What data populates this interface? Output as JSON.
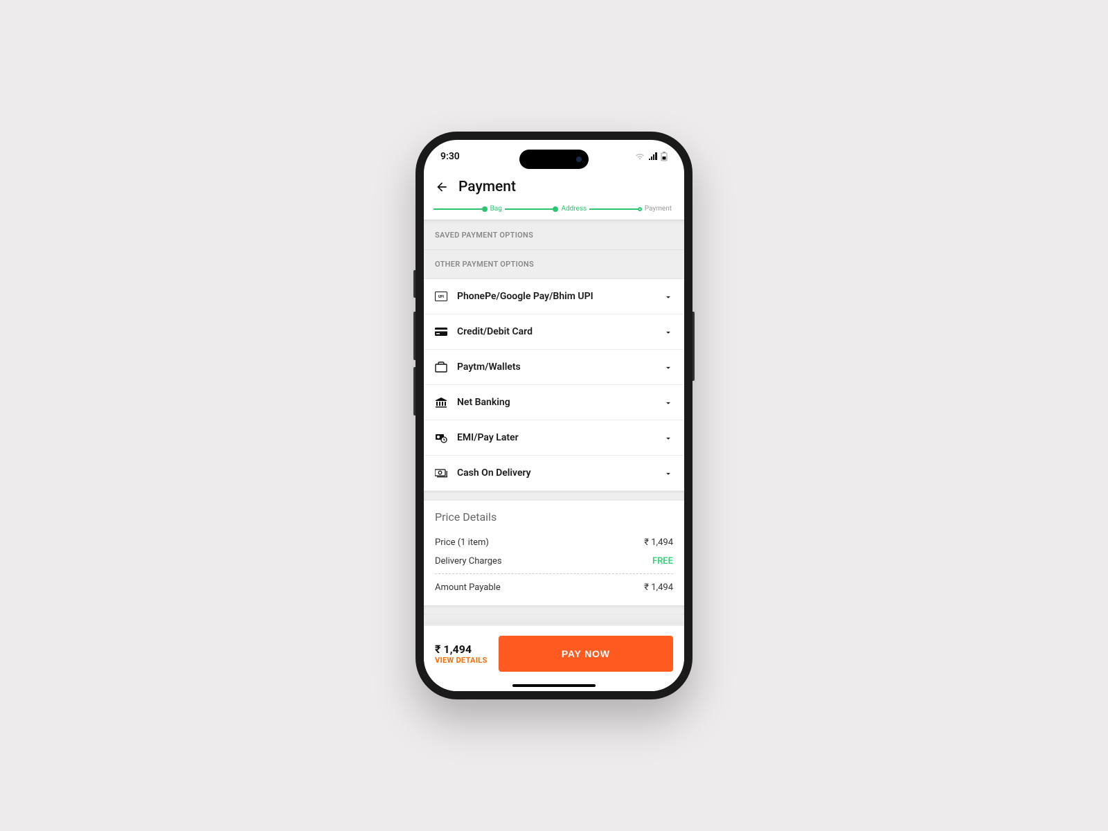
{
  "status": {
    "time": "9:30"
  },
  "header": {
    "title": "Payment"
  },
  "stepper": {
    "steps": [
      "Bag",
      "Address",
      "Payment"
    ]
  },
  "sections": {
    "saved_header": "SAVED PAYMENT OPTIONS",
    "other_header": "OTHER PAYMENT OPTIONS"
  },
  "options": {
    "upi": "PhonePe/Google Pay/Bhim UPI",
    "card": "Credit/Debit Card",
    "wallet": "Paytm/Wallets",
    "netbanking": "Net Banking",
    "emi": "EMI/Pay Later",
    "cod": "Cash On Delivery"
  },
  "price": {
    "title": "Price Details",
    "item_label": "Price (1 item)",
    "item_value": "₹ 1,494",
    "delivery_label": "Delivery Charges",
    "delivery_value": "FREE",
    "payable_label": "Amount Payable",
    "payable_value": "₹ 1,494"
  },
  "footer": {
    "amount": "₹ 1,494",
    "details_link": "VIEW DETAILS",
    "pay_button": "PAY NOW"
  }
}
